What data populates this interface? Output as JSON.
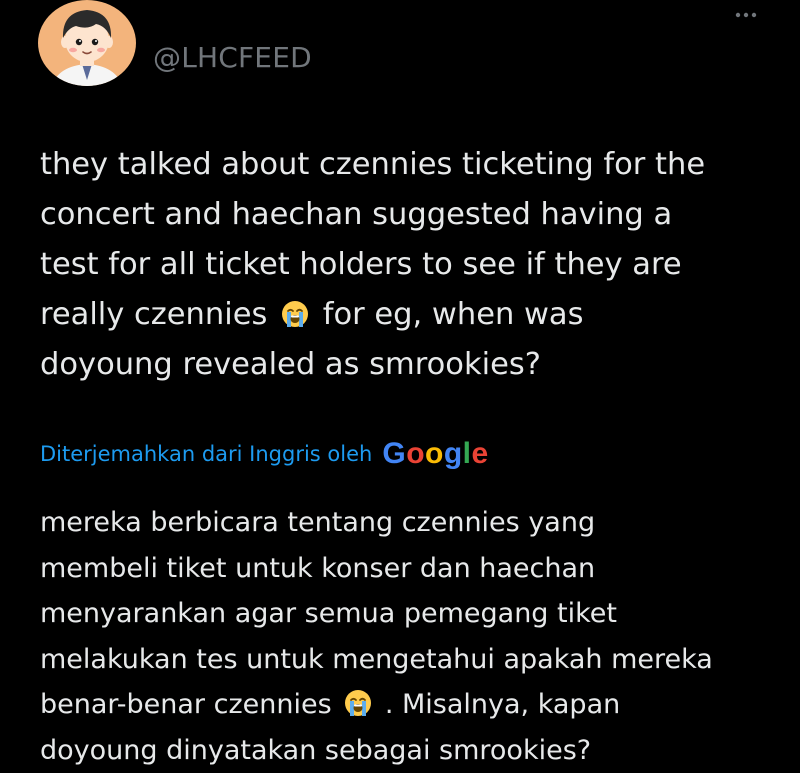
{
  "header": {
    "handle": "@LHCFEED"
  },
  "tweet": {
    "lines": [
      "they talked about czennies ticketing for the",
      "concert and haechan suggested having a",
      "test for all ticket holders to see if they are",
      "really czennies",
      "for eg, when was",
      "doyoung revealed as smrookies?"
    ]
  },
  "translation": {
    "label": "Diterjemahkan dari Inggris oleh",
    "provider": [
      "G",
      "o",
      "o",
      "g",
      "l",
      "e"
    ],
    "lines": [
      "mereka berbicara tentang czennies yang",
      "membeli tiket untuk konser dan haechan",
      "menyarankan agar semua pemegang tiket",
      "melakukan tes untuk mengetahui apakah mereka",
      "benar-benar czennies",
      ". Misalnya, kapan",
      "doyoung dinyatakan sebagai smrookies?"
    ]
  },
  "colors": {
    "background": "#000000",
    "text": "#e7e9ea",
    "muted": "#71767b",
    "link": "#1d9bf0"
  },
  "icons": {
    "avatar": "cartoon-boy-avatar",
    "more": "more-dots-icon",
    "emoji": "loudly-crying-face-emoji"
  }
}
